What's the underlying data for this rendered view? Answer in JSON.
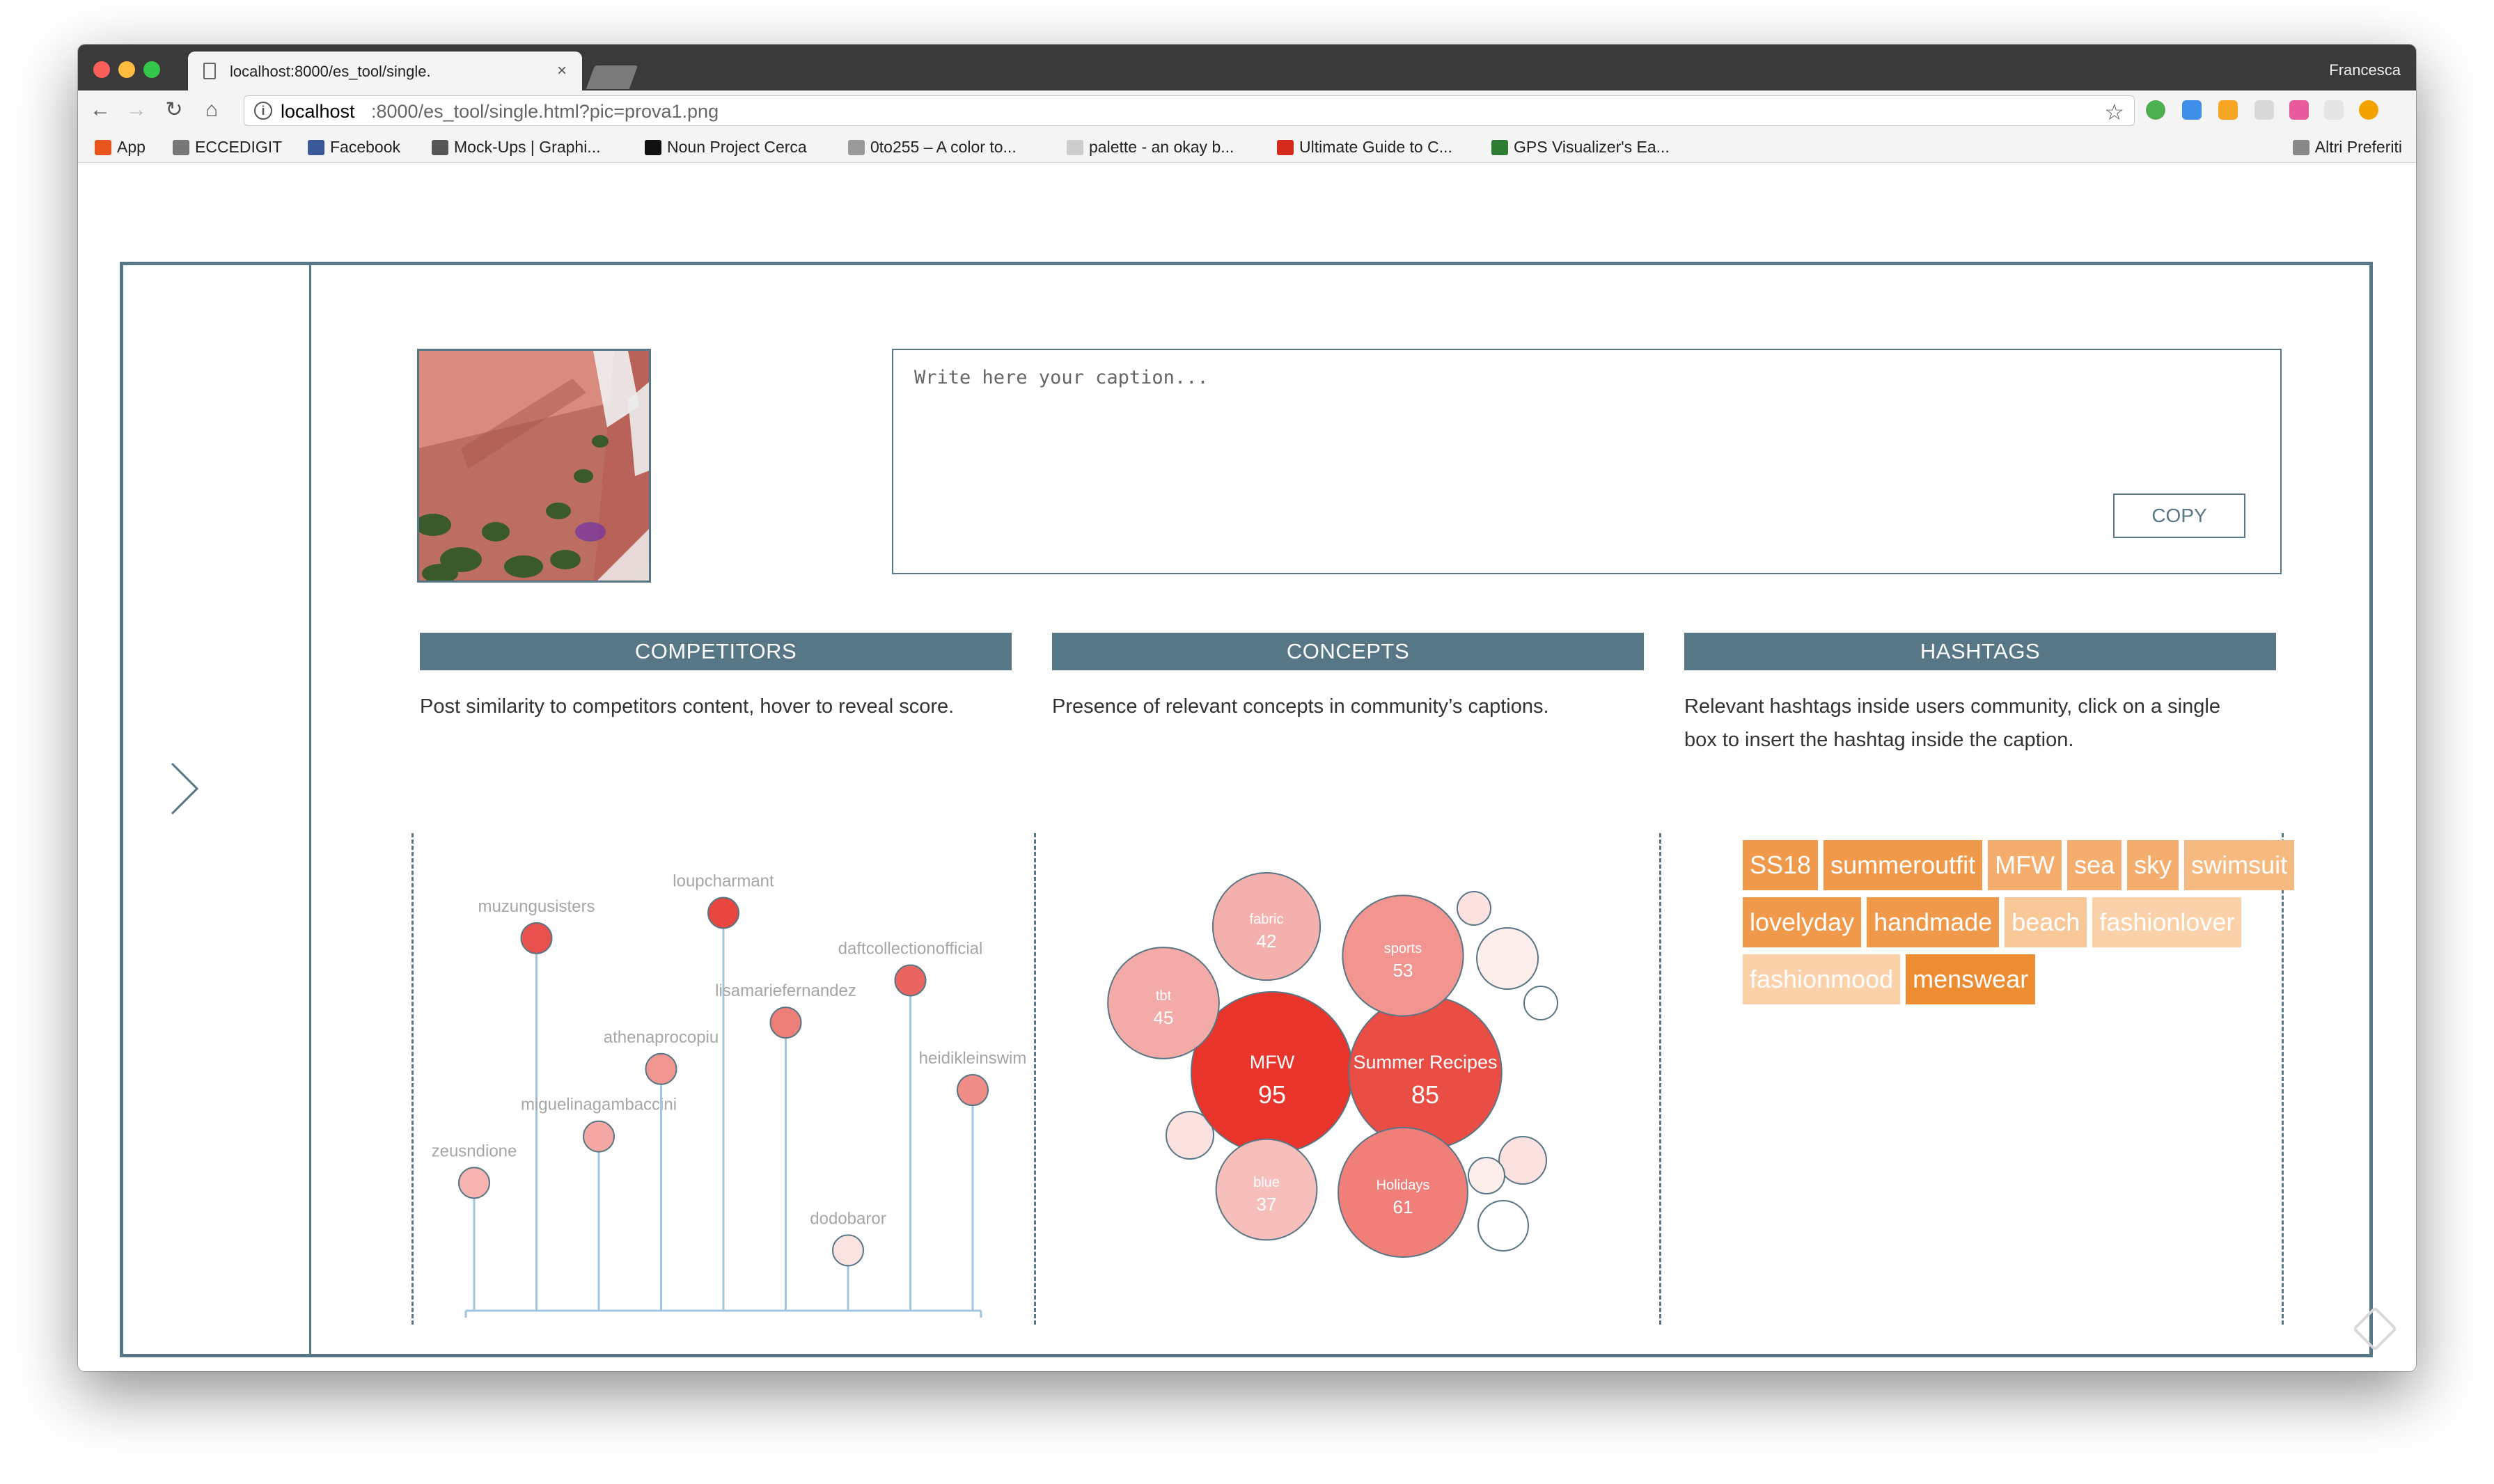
{
  "browser": {
    "tab_title": "localhost:8000/es_tool/single.",
    "tab_close": "×",
    "user": "Francesca",
    "url_host": "localhost",
    "url_path": ":8000/es_tool/single.html?pic=prova1.png",
    "nav": {
      "back": "←",
      "forward": "→",
      "reload": "↻",
      "home": "⌂",
      "star": "☆",
      "info": "i"
    },
    "bookmarks": [
      {
        "label": "App",
        "color": "#e8541d"
      },
      {
        "label": "ECCEDIGIT",
        "color": "#777777"
      },
      {
        "label": "Facebook",
        "color": "#3b5998"
      },
      {
        "label": "Mock-Ups | Graphi...",
        "color": "#555555"
      },
      {
        "label": "Noun Project Cerca",
        "color": "#111111"
      },
      {
        "label": "0to255 – A color to...",
        "color": "#9a9a9a"
      },
      {
        "label": "palette - an okay b...",
        "color": "#cccccc"
      },
      {
        "label": "Ultimate Guide to C...",
        "color": "#d52b1e"
      },
      {
        "label": "GPS Visualizer's Ea...",
        "color": "#2e7d32"
      }
    ],
    "other_bookmarks": "Altri Preferiti"
  },
  "editor": {
    "caption_placeholder": "Write here your caption...",
    "copy_label": "COPY"
  },
  "columns": [
    {
      "title": "COMPETITORS",
      "description": "Post similarity to competitors content, hover to reveal score."
    },
    {
      "title": "CONCEPTS",
      "description": "Presence of relevant concepts in community’s captions."
    },
    {
      "title": "HASHTAGS",
      "description": "Relevant hashtags inside users community, click on a single box to insert the hashtag inside the caption."
    }
  ],
  "chart_data": [
    {
      "type": "scatter",
      "title": "",
      "xlabel": "",
      "ylabel": "",
      "grid": false,
      "points": [
        {
          "name": "zeusndione",
          "value": 0.27,
          "color": "#f6b3b0"
        },
        {
          "name": "muzungusisters",
          "value": 0.85,
          "color": "#e8514e"
        },
        {
          "name": "miguelinagambaccini",
          "value": 0.38,
          "color": "#f4a7a3"
        },
        {
          "name": "athenaprocopiu",
          "value": 0.54,
          "color": "#f09690"
        },
        {
          "name": "loupcharmant",
          "value": 0.91,
          "color": "#e8463f"
        },
        {
          "name": "lisamariefernandez",
          "value": 0.65,
          "color": "#ee7f78"
        },
        {
          "name": "dodobaror",
          "value": 0.11,
          "color": "#fbe3e1"
        },
        {
          "name": "daftcollectionofficial",
          "value": 0.75,
          "color": "#ea6560"
        },
        {
          "name": "heidikleinswim",
          "value": 0.49,
          "color": "#f08d87"
        }
      ],
      "ylim": [
        0,
        1
      ]
    },
    {
      "type": "bubble",
      "title": "",
      "bubbles": [
        {
          "label": "MFW",
          "value": 95,
          "color": "#e8342b"
        },
        {
          "label": "Summer Recipes",
          "value": 85,
          "color": "#ea4d44"
        },
        {
          "label": "Holidays",
          "value": 61,
          "color": "#f07f7a"
        },
        {
          "label": "sports",
          "value": 53,
          "color": "#f29490"
        },
        {
          "label": "tbt",
          "value": 45,
          "color": "#f4aaa6"
        },
        {
          "label": "fabric",
          "value": 42,
          "color": "#f4b0ac"
        },
        {
          "label": "blue",
          "value": 37,
          "color": "#f6bfbc"
        }
      ],
      "minor_bubble_colors": [
        "#fbe2e0",
        "#fdeeec",
        "#ffffff"
      ]
    }
  ],
  "hashtags": [
    {
      "tag": "SS18",
      "color": "#f0994a"
    },
    {
      "tag": "summeroutfit",
      "color": "#f0994a"
    },
    {
      "tag": "MFW",
      "color": "#f4ad6d"
    },
    {
      "tag": "sea",
      "color": "#f4ad6d"
    },
    {
      "tag": "sky",
      "color": "#f4ad6d"
    },
    {
      "tag": "swimsuit",
      "color": "#f6b97f"
    },
    {
      "tag": "lovelyday",
      "color": "#f0994a"
    },
    {
      "tag": "handmade",
      "color": "#f0994a"
    },
    {
      "tag": "beach",
      "color": "#f9c898"
    },
    {
      "tag": "fashionlover",
      "color": "#fbd1aa"
    },
    {
      "tag": "fashionmood",
      "color": "#fbd1aa"
    },
    {
      "tag": "menswear",
      "color": "#ee8c32"
    }
  ]
}
